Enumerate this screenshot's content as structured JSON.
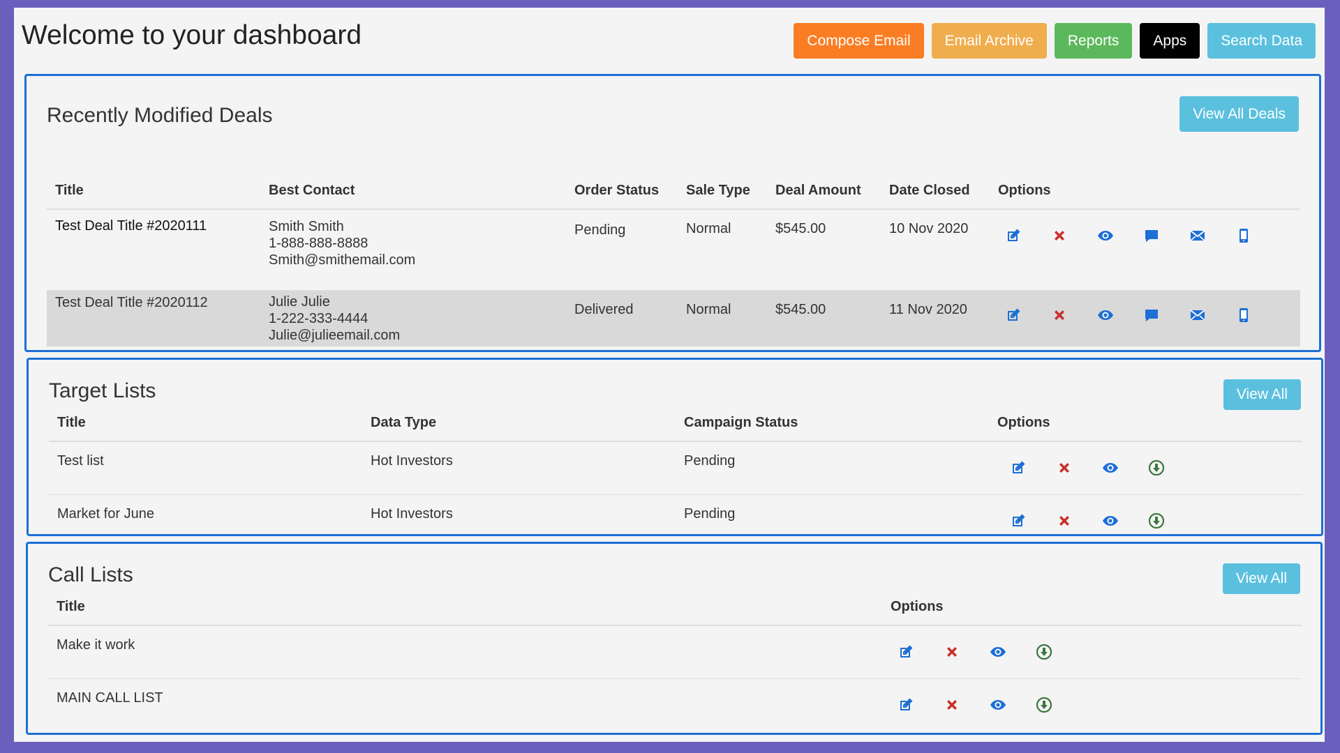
{
  "header": {
    "title": "Welcome to your dashboard",
    "buttons": {
      "compose": "Compose Email",
      "archive": "Email Archive",
      "reports": "Reports",
      "apps": "Apps",
      "search": "Search Data"
    }
  },
  "deals": {
    "title": "Recently Modified Deals",
    "view_all": "View All Deals",
    "columns": [
      "Title",
      "Best Contact",
      "Order Status",
      "Sale Type",
      "Deal Amount",
      "Date Closed",
      "Options"
    ],
    "rows": [
      {
        "title": "Test Deal Title #2020111",
        "contact_name": "Smith Smith",
        "contact_phone": "1-888-888-8888",
        "contact_email": "Smith@smithemail.com",
        "status": "Pending",
        "sale_type": "Normal",
        "amount": "$545.00",
        "date_closed": "10 Nov 2020"
      },
      {
        "title": "Test Deal Title #2020112",
        "contact_name": "Julie Julie",
        "contact_phone": "1-222-333-4444",
        "contact_email": "Julie@julieemail.com",
        "status": "Delivered",
        "sale_type": "Normal",
        "amount": "$545.00",
        "date_closed": "11 Nov 2020"
      }
    ]
  },
  "targets": {
    "title": "Target Lists",
    "view_all": "View All",
    "columns": [
      "Title",
      "Data Type",
      "Campaign Status",
      "Options"
    ],
    "rows": [
      {
        "title": "Test list",
        "data_type": "Hot Investors",
        "status": "Pending"
      },
      {
        "title": "Market for June",
        "data_type": "Hot Investors",
        "status": "Pending"
      }
    ]
  },
  "calls": {
    "title": "Call Lists",
    "view_all": "View All",
    "columns": [
      "Title",
      "Options"
    ],
    "rows": [
      {
        "title": "Make it work"
      },
      {
        "title": "MAIN CALL LIST"
      }
    ]
  },
  "icons": {
    "edit": "edit-icon",
    "delete": "delete-icon",
    "view": "eye-icon",
    "sms": "chat-icon",
    "email": "envelope-icon",
    "mobile": "mobile-icon",
    "download": "download-icon"
  },
  "colors": {
    "panel_border": "#1d6fd6",
    "icon_blue": "#1d6fd6",
    "icon_red": "#c9302c",
    "icon_green": "#3c763d"
  }
}
